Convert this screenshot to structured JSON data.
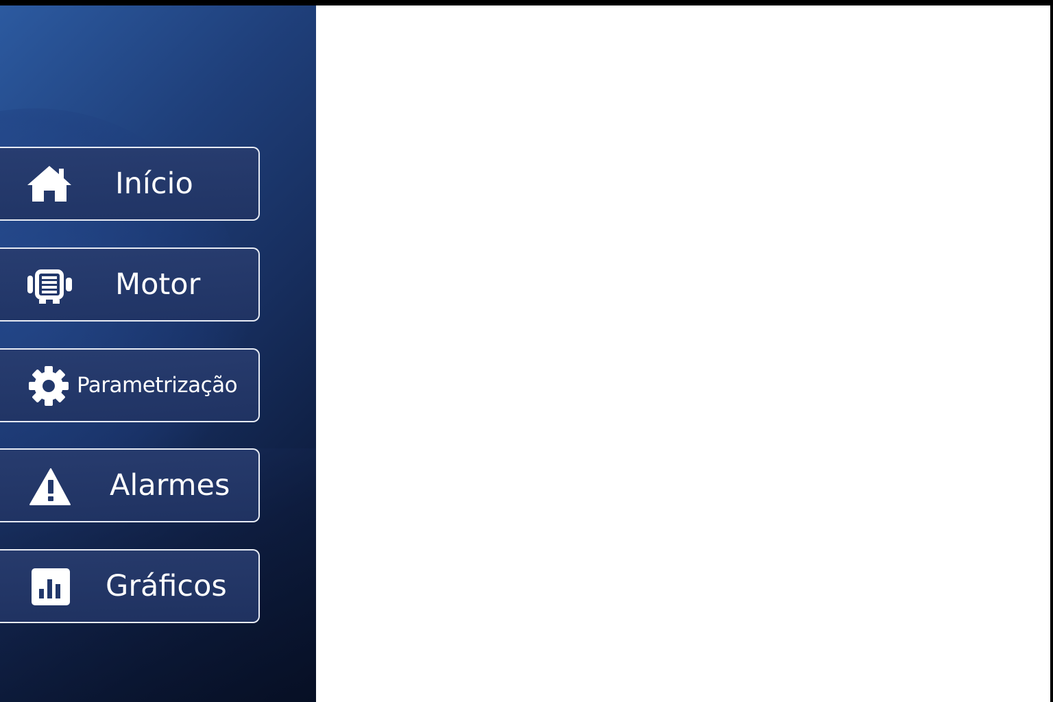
{
  "sidebar": {
    "items": [
      {
        "label": "Início",
        "icon": "home-icon"
      },
      {
        "label": "Motor",
        "icon": "motor-icon"
      },
      {
        "label": "Parametrização",
        "icon": "gear-icon"
      },
      {
        "label": "Alarmes",
        "icon": "warning-icon"
      },
      {
        "label": "Gráficos",
        "icon": "bar-chart-icon"
      }
    ]
  },
  "colors": {
    "sidebar_top": "#2c5aa0",
    "sidebar_bottom": "#08122a",
    "button_border": "#e8ecf5",
    "text": "#ffffff",
    "content_background": "#ffffff"
  }
}
